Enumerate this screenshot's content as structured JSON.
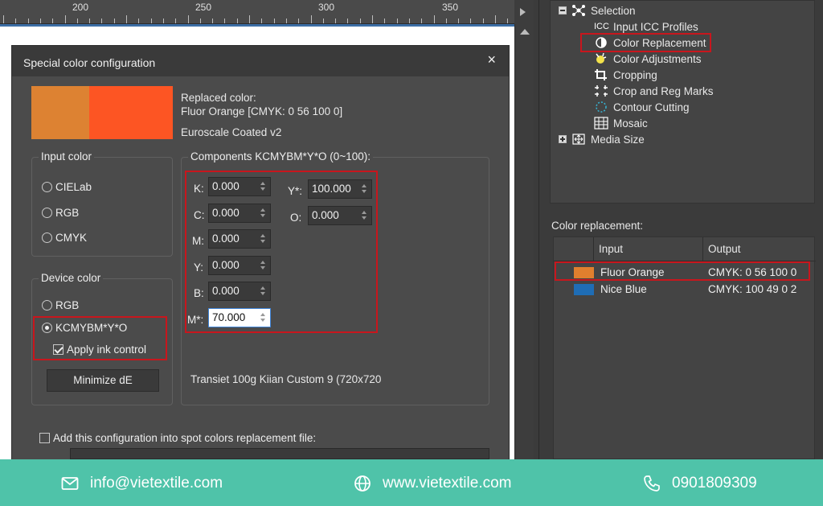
{
  "ruler": {
    "labels": [
      "200",
      "250",
      "300",
      "350"
    ]
  },
  "dialog": {
    "title": "Special color configuration",
    "close_glyph": "×",
    "swatches": {
      "left_color": "#dd8232",
      "right_color": "#fd5523"
    },
    "replaced_label": "Replaced color:",
    "replaced_name": "Fluor Orange  [CMYK: 0 56 100 0]",
    "profile": "Euroscale Coated v2",
    "input_color": {
      "title": "Input color",
      "options": [
        "CIELab",
        "RGB",
        "CMYK"
      ]
    },
    "device_color": {
      "title": "Device color",
      "options": [
        "RGB",
        "KCMYBM*Y*O"
      ],
      "apply_ink_control": "Apply ink control",
      "minimize_button": "Minimize dE"
    },
    "components": {
      "title": "Components KCMYBM*Y*O (0~100):",
      "fields": [
        {
          "label": "K:",
          "value": "0.000"
        },
        {
          "label": "C:",
          "value": "0.000"
        },
        {
          "label": "M:",
          "value": "0.000"
        },
        {
          "label": "Y:",
          "value": "0.000"
        },
        {
          "label": "B:",
          "value": "0.000"
        },
        {
          "label": "M*:",
          "value": "70.000"
        }
      ],
      "fields_right": [
        {
          "label": "Y*:",
          "value": "100.000"
        },
        {
          "label": "O:",
          "value": "0.000"
        }
      ],
      "device_info": "Transiet   100g   Kiian   Custom 9 (720x720"
    },
    "add_config_label": "Add this configuration into spot colors replacement file:"
  },
  "tree": {
    "items": [
      {
        "label": "Selection",
        "icon": "selection-icon"
      },
      {
        "label": "Input ICC Profiles",
        "icon": "icc-icon",
        "icon_text": "ICC"
      },
      {
        "label": "Color Replacement",
        "icon": "color-replacement-icon"
      },
      {
        "label": "Color Adjustments",
        "icon": "color-adjustments-icon"
      },
      {
        "label": "Cropping",
        "icon": "cropping-icon"
      },
      {
        "label": "Crop and Reg Marks",
        "icon": "crop-marks-icon"
      },
      {
        "label": "Contour Cutting",
        "icon": "contour-cutting-icon"
      },
      {
        "label": "Mosaic",
        "icon": "mosaic-icon"
      },
      {
        "label": "Media Size",
        "icon": "media-size-icon"
      }
    ]
  },
  "color_replacement": {
    "title": "Color replacement:",
    "columns": [
      "Input",
      "Output"
    ],
    "rows": [
      {
        "color": "#e07f2e",
        "input": "Fluor Orange",
        "output": "CMYK: 0 56 100 0"
      },
      {
        "color": "#1f6db5",
        "input": "Nice Blue",
        "output": "CMYK: 100 49 0 2"
      }
    ]
  },
  "footer": {
    "email": "info@vietextile.com",
    "website": "www.vietextile.com",
    "phone": "0901809309",
    "background": "#4fc3a9"
  }
}
